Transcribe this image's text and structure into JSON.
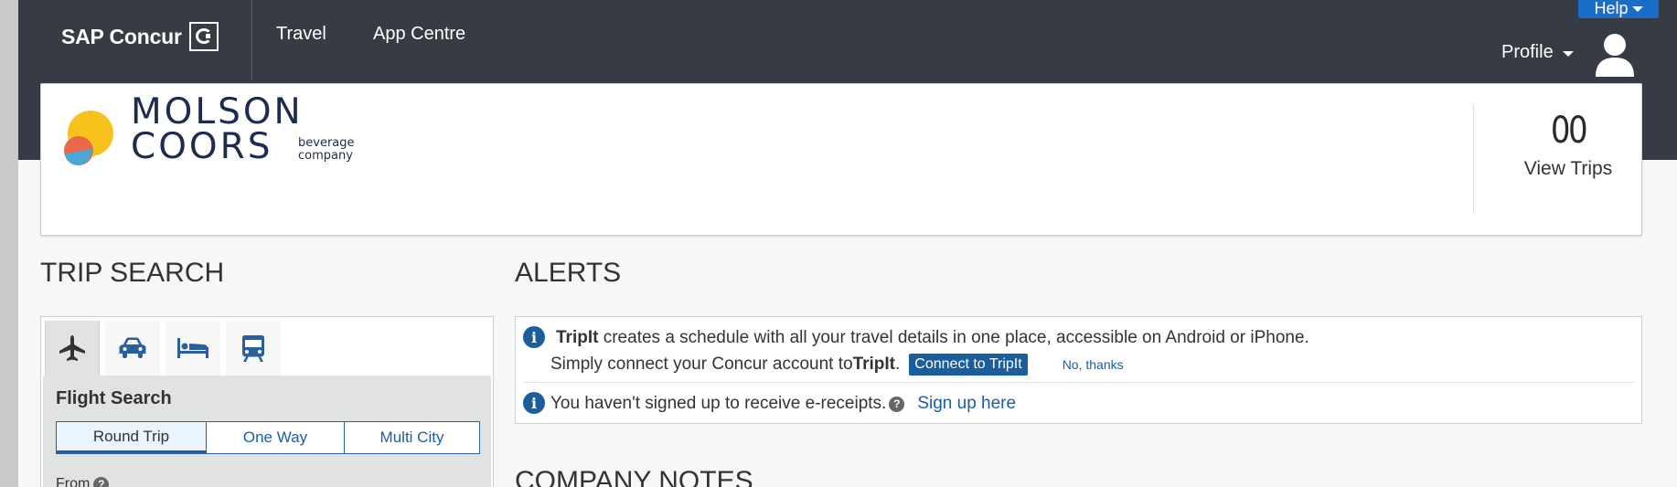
{
  "header": {
    "brand": "SAP Concur",
    "nav": [
      "Travel",
      "App Centre"
    ],
    "help_label": "Help",
    "profile_label": "Profile"
  },
  "company": {
    "logo_line1": "MOLSON",
    "logo_line2": "COORS",
    "logo_sub1": "beverage",
    "logo_sub2": "company",
    "trips_count": "00",
    "view_trips_label": "View Trips"
  },
  "trip_search": {
    "title": "TRIP SEARCH",
    "modes": [
      "airplane-icon",
      "car-icon",
      "hotel-bed-icon",
      "train-icon"
    ],
    "active_mode": 0,
    "section_label": "Flight Search",
    "trip_types": [
      "Round Trip",
      "One Way",
      "Multi City"
    ],
    "selected_trip_type": "Round Trip",
    "from_label": "From"
  },
  "alerts": {
    "title": "ALERTS",
    "tripit": {
      "brand": "TripIt",
      "text1": " creates a schedule with all your travel details in one place, accessible on Android or iPhone.",
      "text2_prefix": "Simply connect your Concur account to ",
      "text2_brand": "TripIt",
      "text2_suffix": ".",
      "connect_label": "Connect to TripIt",
      "no_thanks_label": "No, thanks"
    },
    "ereceipts": {
      "text": "You haven't signed up to receive e-receipts.",
      "signup_label": "Sign up here"
    }
  },
  "company_notes": {
    "title": "COMPANY NOTES"
  },
  "colors": {
    "topbar": "#373c44",
    "accent_blue": "#1c5d9c",
    "help_blue": "#1a6ec7",
    "link_blue": "#1a5ea8"
  }
}
